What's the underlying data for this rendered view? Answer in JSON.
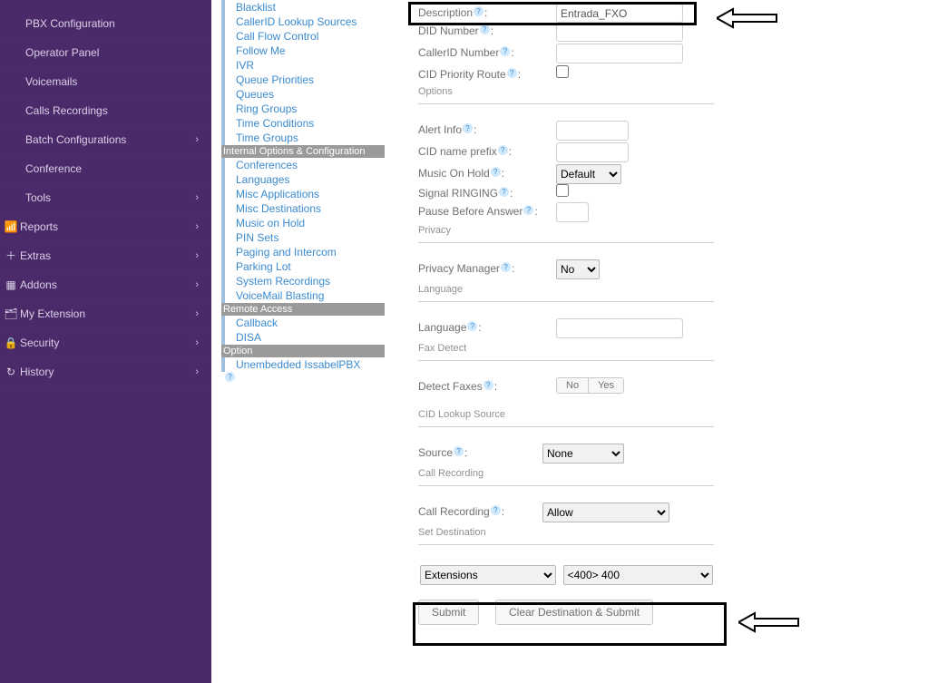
{
  "sidebar": {
    "sub": {
      "pbxconfig": "PBX Configuration",
      "operator": "Operator Panel",
      "voicemails": "Voicemails",
      "recordings": "Calls Recordings",
      "batch": "Batch Configurations",
      "conference": "Conference",
      "tools": "Tools"
    },
    "main": {
      "reports": "Reports",
      "extras": "Extras",
      "addons": "Addons",
      "myext": "My Extension",
      "security": "Security",
      "history": "History"
    }
  },
  "menu": {
    "items1": [
      "Blacklist",
      "CallerID Lookup Sources",
      "Call Flow Control",
      "Follow Me",
      "IVR",
      "Queue Priorities",
      "Queues",
      "Ring Groups",
      "Time Conditions",
      "Time Groups"
    ],
    "head1": "Internal Options & Configuration",
    "items2": [
      "Conferences",
      "Languages",
      "Misc Applications",
      "Misc Destinations",
      "Music on Hold",
      "PIN Sets",
      "Paging and Intercom",
      "Parking Lot",
      "System Recordings",
      "VoiceMail Blasting"
    ],
    "head2": "Remote Access",
    "items3": [
      "Callback",
      "DISA"
    ],
    "head3": "Option",
    "items4": [
      "Unembedded IssabelPBX"
    ]
  },
  "form": {
    "description_lbl": "Description",
    "description_val": "Entrada_FXO",
    "did_lbl": "DID Number",
    "cid_lbl": "CallerID Number",
    "cidpr_lbl": "CID Priority Route",
    "options_sect": "Options",
    "alert_lbl": "Alert Info",
    "cidprefix_lbl": "CID name prefix",
    "moh_lbl": "Music On Hold",
    "moh_val": "Default",
    "signal_lbl": "Signal RINGING",
    "pause_lbl": "Pause Before Answer",
    "privacy_sect": "Privacy",
    "privmgr_lbl": "Privacy Manager",
    "privmgr_val": "No",
    "language_sect": "Language",
    "language_lbl": "Language",
    "fax_sect": "Fax Detect",
    "detectfax_lbl": "Detect Faxes",
    "detectfax_no": "No",
    "detectfax_yes": "Yes",
    "cidlookup_sect": "CID Lookup Source",
    "source_lbl": "Source",
    "source_val": "None",
    "callrec_sect": "Call Recording",
    "callrec_lbl": "Call Recording",
    "callrec_val": "Allow",
    "setdest_sect": "Set Destination",
    "dest_type": "Extensions",
    "dest_val": "<400> 400",
    "submit_lbl": "Submit",
    "clear_lbl": "Clear Destination & Submit"
  }
}
